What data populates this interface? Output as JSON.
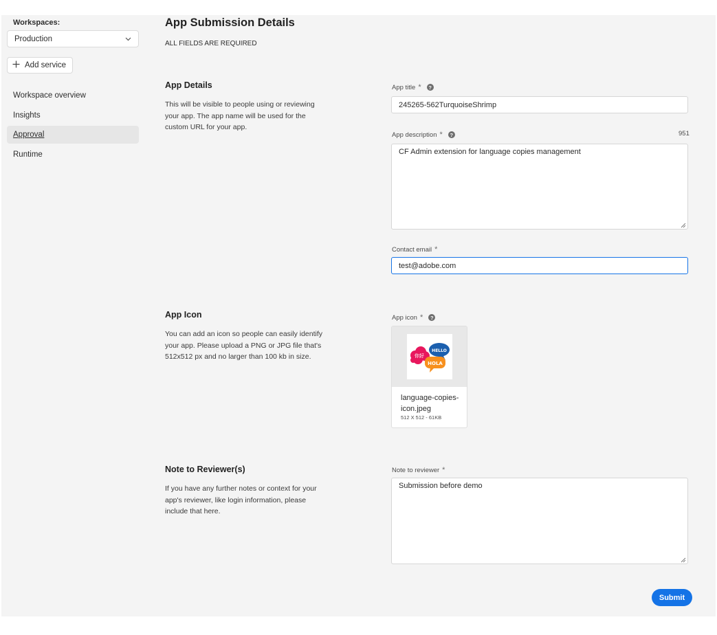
{
  "sidebar": {
    "workspaces_label": "Workspaces:",
    "workspace_selected": "Production",
    "add_service_label": "Add service",
    "items": [
      {
        "label": "Workspace overview",
        "active": false
      },
      {
        "label": "Insights",
        "active": false
      },
      {
        "label": "Approval",
        "active": true
      },
      {
        "label": "Runtime",
        "active": false
      }
    ]
  },
  "header": {
    "title": "App Submission Details",
    "subtitle": "ALL FIELDS ARE REQUIRED"
  },
  "sections": {
    "app_details": {
      "heading": "App Details",
      "description": "This will be visible to people using or reviewing your app. The app name will be used for the custom URL for your app."
    },
    "app_icon": {
      "heading": "App Icon",
      "description": "You can add an icon so people can easily identify your app. Please upload a PNG or JPG file that's 512x512 px and no larger than 100 kb in size."
    },
    "note": {
      "heading": "Note to Reviewer(s)",
      "description": "If you have any further notes or context for your app's reviewer, like login information, please include that here."
    }
  },
  "form": {
    "app_title": {
      "label": "App title",
      "value": "245265-562TurquoiseShrimp"
    },
    "app_description": {
      "label": "App description",
      "value": "CF Admin extension for language copies management",
      "remaining_chars": "951"
    },
    "contact_email": {
      "label": "Contact email",
      "value": "test@adobe.com"
    },
    "app_icon": {
      "label": "App icon",
      "file_name": "language-copies-icon.jpeg",
      "file_meta": "512 X 512 - 61KB",
      "bubbles": [
        "你好",
        "HELLO",
        "HOLA"
      ],
      "bubble_colors": {
        "pink": "#e8175d",
        "blue": "#1b5fae",
        "orange": "#f7901e"
      }
    },
    "note_to_reviewer": {
      "label": "Note to reviewer",
      "value": "Submission before demo"
    },
    "required_mark": "*",
    "help_mark": "?"
  },
  "actions": {
    "submit_label": "Submit"
  },
  "colors": {
    "accent": "#1473e6",
    "page_bg": "#f4f4f4",
    "active_nav_bg": "#e6e6e6"
  }
}
